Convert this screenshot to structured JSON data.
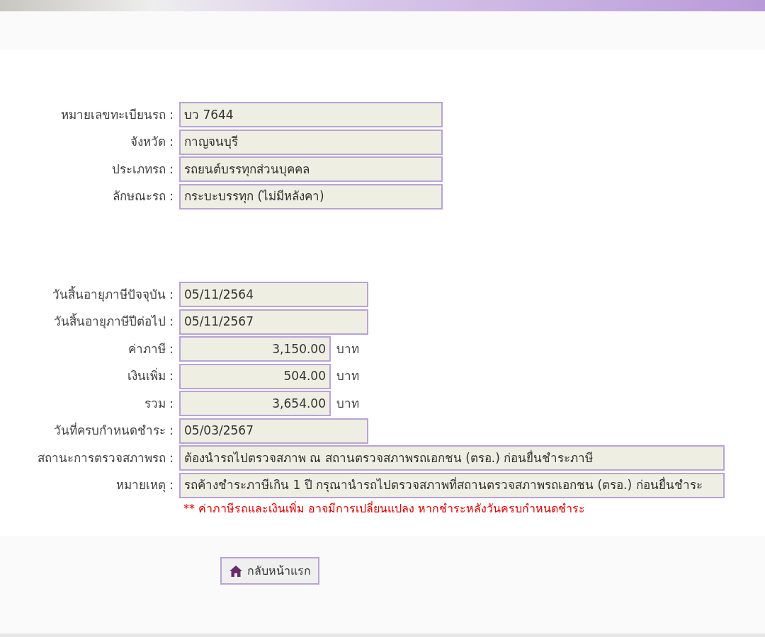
{
  "vehicle": [
    {
      "label": "หมายเลขทะเบียนรถ :",
      "value": "บว 7644"
    },
    {
      "label": "จังหวัด :",
      "value": "กาญจนบุรี"
    },
    {
      "label": "ประเภทรถ :",
      "value": "รถยนต์บรรทุกส่วนบุคคล"
    },
    {
      "label": "ลักษณะรถ :",
      "value": "กระบะบรรทุก (ไม่มีหลังคา)"
    }
  ],
  "tax": [
    {
      "kind": "date",
      "label": "วันสิ้นอายุภาษีปัจจุบัน :",
      "value": "05/11/2564"
    },
    {
      "kind": "date",
      "label": "วันสิ้นอายุภาษีปีต่อไป :",
      "value": "05/11/2567"
    },
    {
      "kind": "amount",
      "label": "ค่าภาษี :",
      "value": "3,150.00",
      "unit": "บาท"
    },
    {
      "kind": "amount",
      "label": "เงินเพิ่ม :",
      "value": "504.00",
      "unit": "บาท"
    },
    {
      "kind": "amount",
      "label": "รวม :",
      "value": "3,654.00",
      "unit": "บาท"
    },
    {
      "kind": "date",
      "label": "วันที่ครบกำหนดชำระ :",
      "value": "05/03/2567"
    },
    {
      "kind": "long",
      "label": "สถานะการตรวจสภาพรถ :",
      "value": "ต้องนำรถไปตรวจสภาพ ณ สถานตรวจสภาพรถเอกชน (ตรอ.) ก่อนยื่นชำระภาษี"
    },
    {
      "kind": "long",
      "label": "หมายเหตุ :",
      "value": "รถค้างชำระภาษีเกิน 1 ปี กรุณานำรถไปตรวจสภาพที่สถานตรวจสภาพรถเอกชน (ตรอ.) ก่อนยื่นชำระ"
    }
  ],
  "warning": "** ค่าภาษีรถและเงินเพิ่ม อาจมีการเปลี่ยนแปลง หากชำระหลังวันครบกำหนดชำระ",
  "home_button": "กลับหน้าแรก"
}
